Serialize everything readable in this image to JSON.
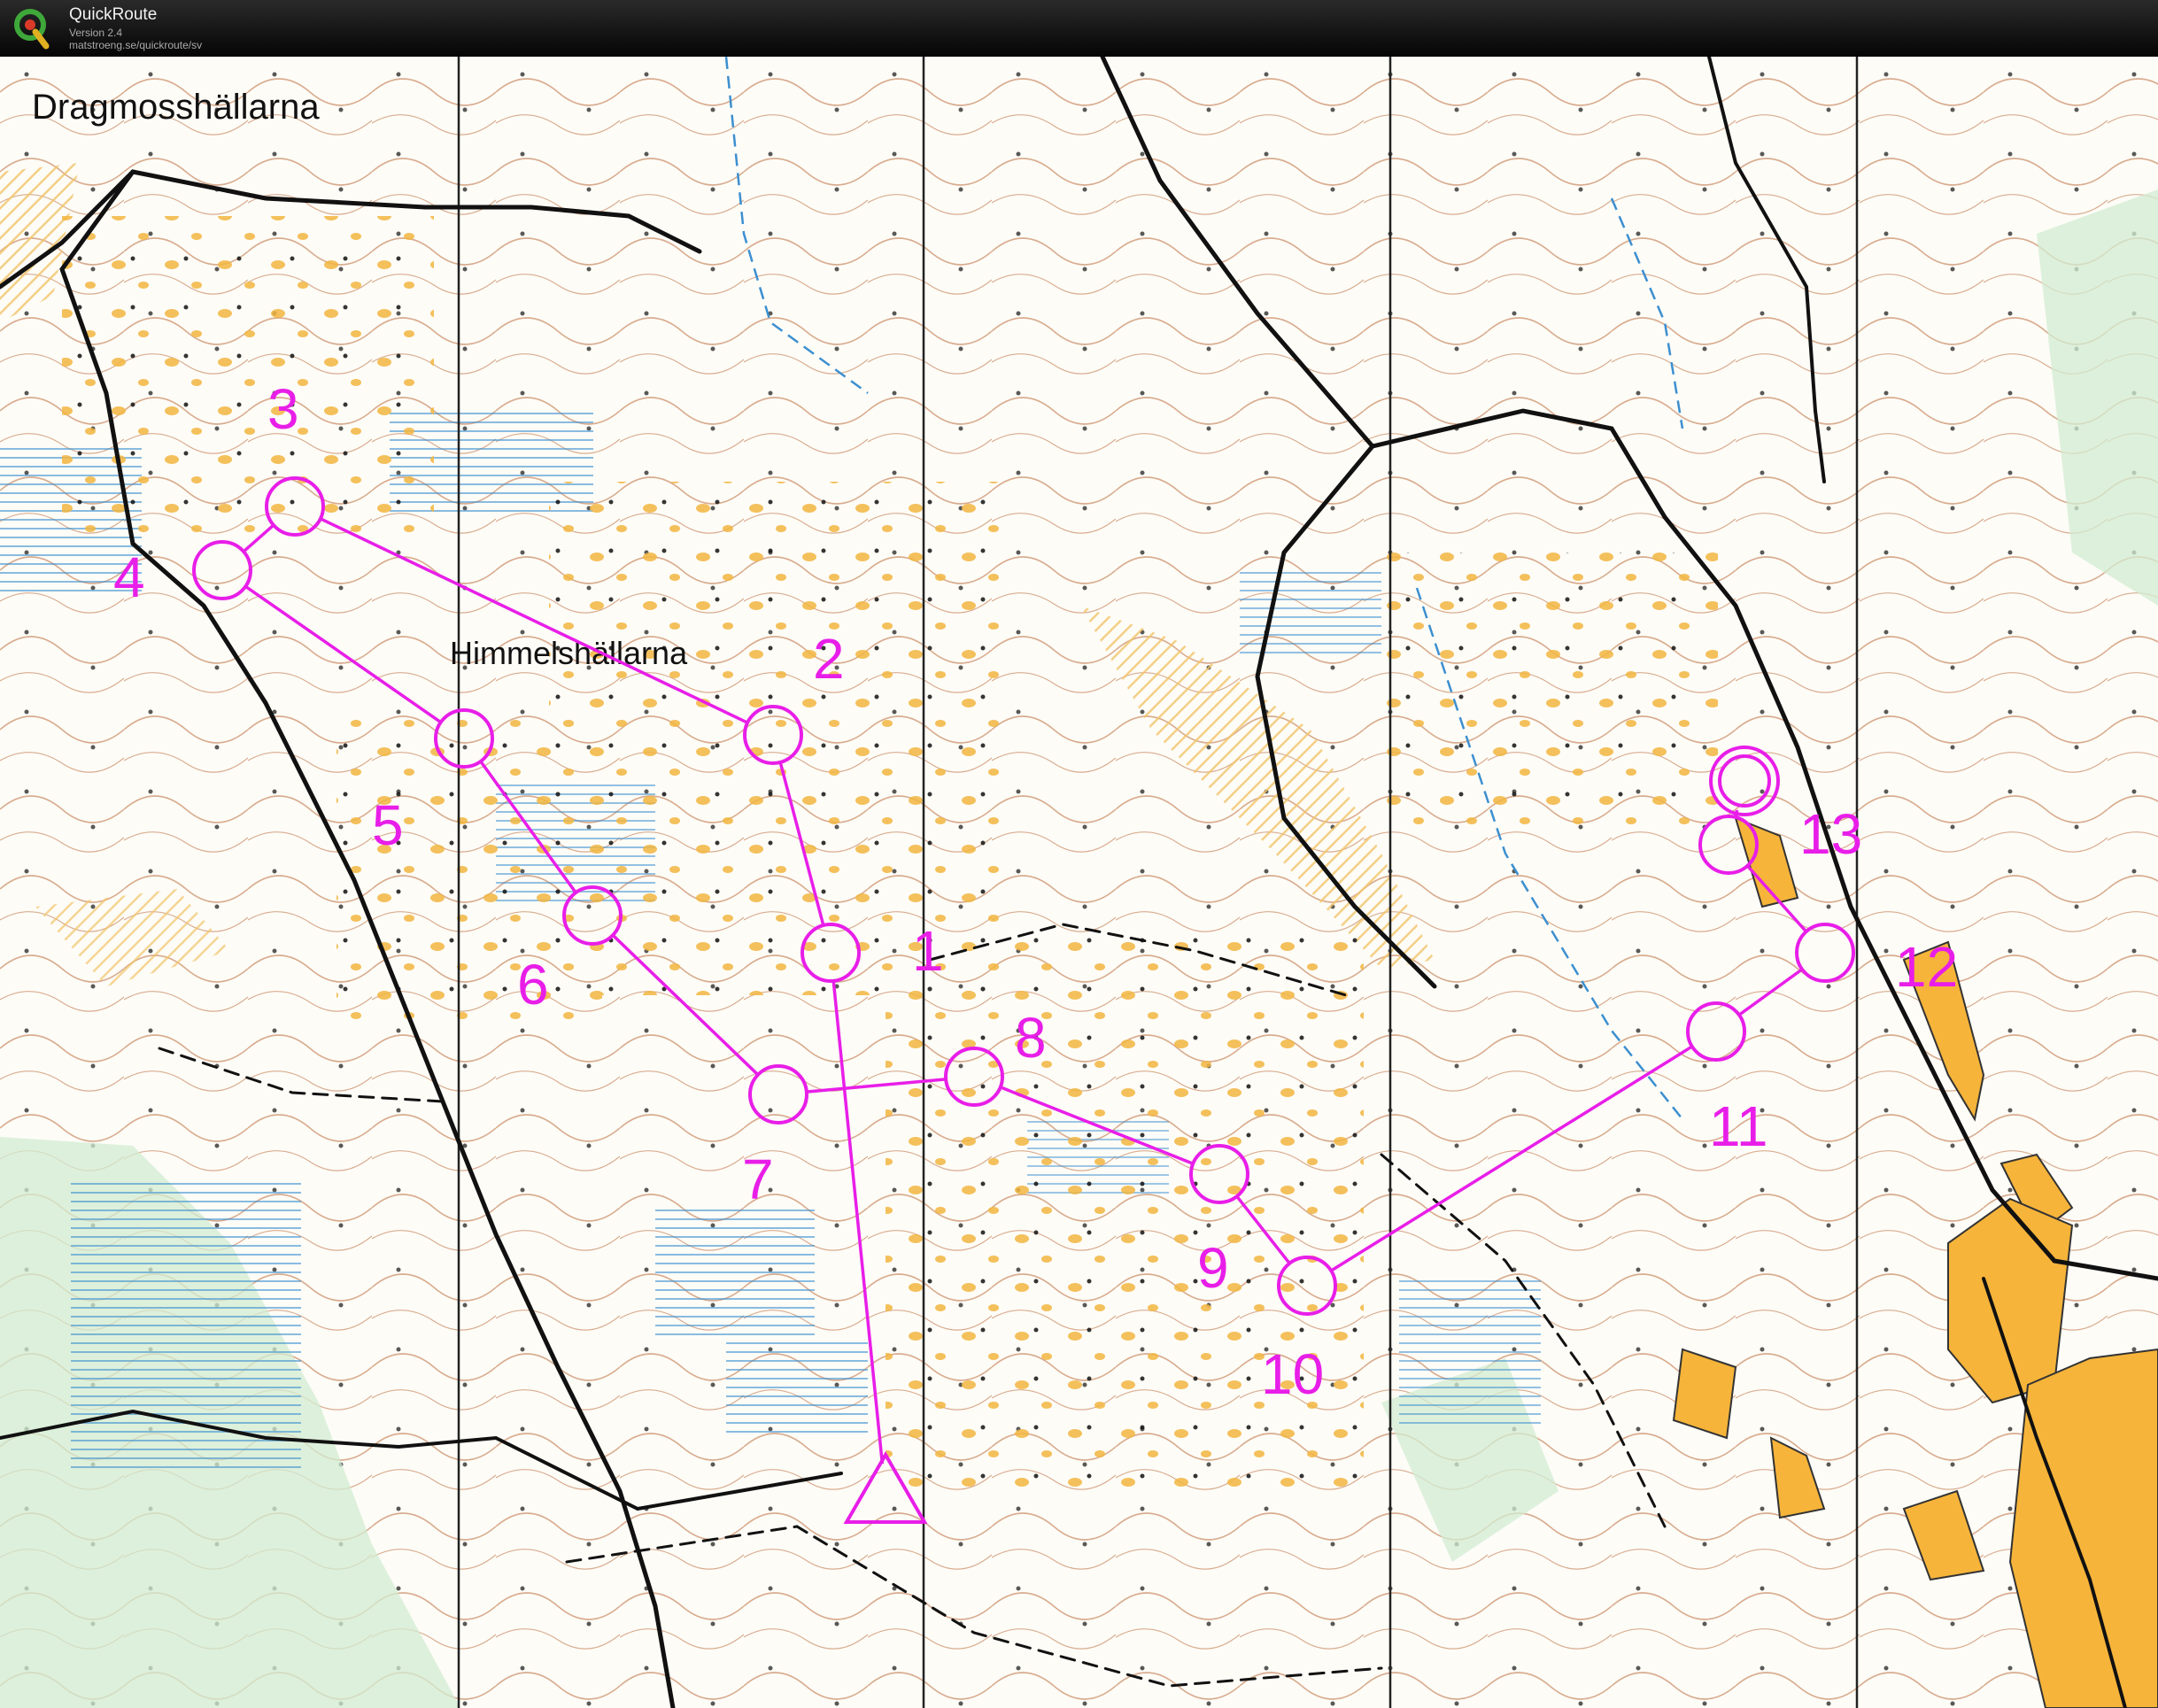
{
  "app": {
    "name": "QuickRoute",
    "version": "Version 2.4",
    "url": "matstroeng.se/quickroute/sv",
    "logo_letter": "Q"
  },
  "map": {
    "place_names": [
      {
        "text": "Dragmosshällarna"
      },
      {
        "text": "Himmelshällarna"
      }
    ],
    "course_color": "#e81ee8",
    "course": {
      "start": {
        "symbol": "start-triangle"
      },
      "controls": [
        {
          "number": "1"
        },
        {
          "number": "2"
        },
        {
          "number": "3"
        },
        {
          "number": "4"
        },
        {
          "number": "5"
        },
        {
          "number": "6"
        },
        {
          "number": "7"
        },
        {
          "number": "8"
        },
        {
          "number": "9"
        },
        {
          "number": "10"
        },
        {
          "number": "11"
        },
        {
          "number": "12"
        },
        {
          "number": "13"
        }
      ],
      "finish": {
        "symbol": "finish-double-circle"
      }
    }
  }
}
